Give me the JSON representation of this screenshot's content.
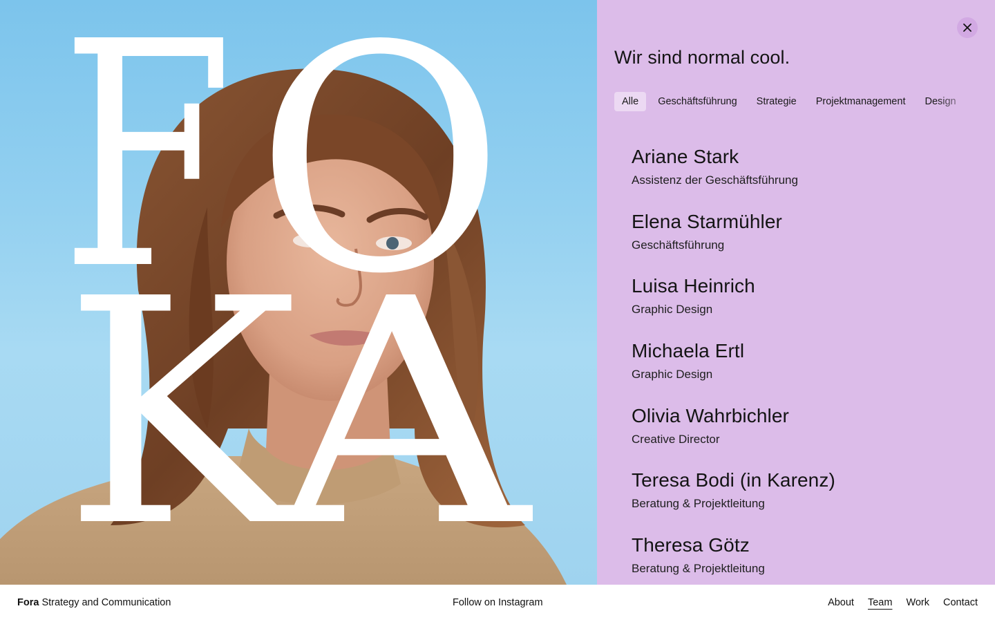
{
  "hero": {
    "logo_letters": [
      "F",
      "O",
      "K",
      "A"
    ],
    "sky_color": "#93d0f0",
    "letter_color": "#ffffff"
  },
  "panel": {
    "background": "#dcbce9",
    "close_icon": "close-icon",
    "title": "Wir sind normal cool.",
    "filters": [
      {
        "label": "Alle",
        "active": true
      },
      {
        "label": "Geschäftsführung",
        "active": false
      },
      {
        "label": "Strategie",
        "active": false
      },
      {
        "label": "Projektmanagement",
        "active": false
      },
      {
        "label": "Design",
        "active": false
      }
    ],
    "members": [
      {
        "name": "Ariane Stark",
        "role": "Assistenz der Geschäftsführung"
      },
      {
        "name": "Elena Starmühler",
        "role": "Geschäftsführung"
      },
      {
        "name": "Luisa Heinrich",
        "role": "Graphic Design"
      },
      {
        "name": "Michaela Ertl",
        "role": "Graphic Design"
      },
      {
        "name": "Olivia Wahrbichler",
        "role": "Creative Director"
      },
      {
        "name": "Teresa Bodi (in Karenz)",
        "role": "Beratung & Projektleitung"
      },
      {
        "name": "Theresa Götz",
        "role": "Beratung & Projektleitung"
      }
    ]
  },
  "footer": {
    "brand_bold": "Fora",
    "brand_rest": " Strategy and Communication",
    "instagram": "Follow on Instagram",
    "nav": [
      {
        "label": "About",
        "active": false
      },
      {
        "label": "Team",
        "active": true
      },
      {
        "label": "Work",
        "active": false
      },
      {
        "label": "Contact",
        "active": false
      }
    ]
  }
}
